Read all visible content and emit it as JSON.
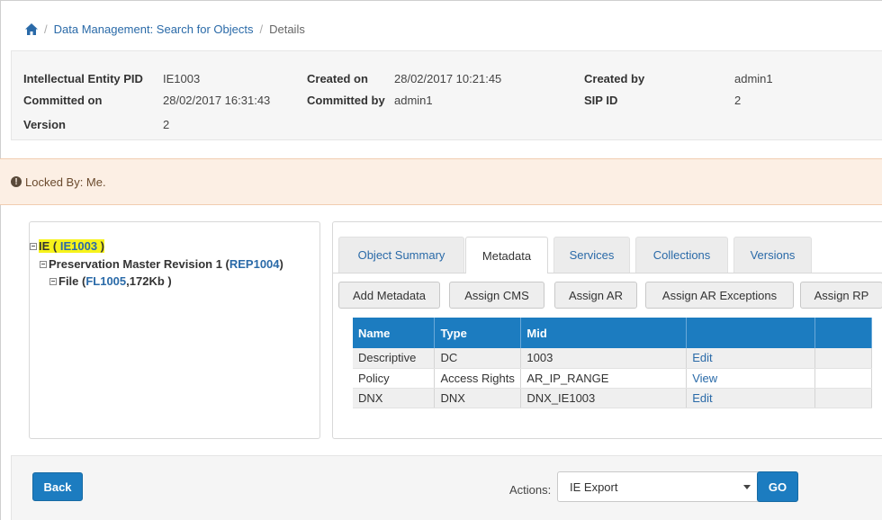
{
  "breadcrumb": {
    "home_icon": "home-icon",
    "items": [
      "Data Management: Search for Objects",
      "Details"
    ],
    "separator": "/"
  },
  "info": {
    "ie_pid_label": "Intellectual Entity PID",
    "ie_pid_value": "IE1003",
    "committed_on_label": "Committed on",
    "committed_on_value": "28/02/2017 16:31:43",
    "version_label": "Version",
    "version_value": "2",
    "created_on_label": "Created on",
    "created_on_value": "28/02/2017 10:21:45",
    "committed_by_label": "Committed by",
    "committed_by_value": "admin1",
    "created_by_label": "Created by",
    "created_by_value": "admin1",
    "sip_id_label": "SIP ID",
    "sip_id_value": "2"
  },
  "lock": {
    "icon": "exclamation-circle-icon",
    "text": "Locked By: Me."
  },
  "tree": {
    "ie_prefix": "IE ( ",
    "ie_id": "IE1003",
    "ie_suffix": " )",
    "rep_prefix": "Preservation Master Revision 1 ( ",
    "rep_id": "REP1004",
    "rep_suffix": " )",
    "file_prefix": "File ( ",
    "file_id": "FL1005",
    "file_suffix": " ,172Kb )"
  },
  "tabs": [
    "Object Summary",
    "Metadata",
    "Services",
    "Collections",
    "Versions"
  ],
  "active_tab": "Metadata",
  "buttons": [
    "Add Metadata",
    "Assign CMS",
    "Assign AR",
    "Assign AR Exceptions",
    "Assign RP"
  ],
  "table": {
    "headers": [
      "Name",
      "Type",
      "Mid",
      "",
      ""
    ],
    "rows": [
      {
        "name": "Descriptive",
        "type": "DC",
        "mid": "1003",
        "action": "Edit"
      },
      {
        "name": "Policy",
        "type": "Access Rights",
        "mid": "AR_IP_RANGE",
        "action": "View"
      },
      {
        "name": "DNX",
        "type": "DNX",
        "mid": "DNX_IE1003",
        "action": "Edit"
      }
    ]
  },
  "footer": {
    "back_label": "Back",
    "actions_label": "Actions:",
    "actions_selected": "IE Export",
    "go_label": "GO"
  },
  "colors": {
    "primary": "#1c7cc0",
    "link": "#2a6aa8",
    "lock_bg": "#fcefe4",
    "highlight": "#f7f31b"
  }
}
